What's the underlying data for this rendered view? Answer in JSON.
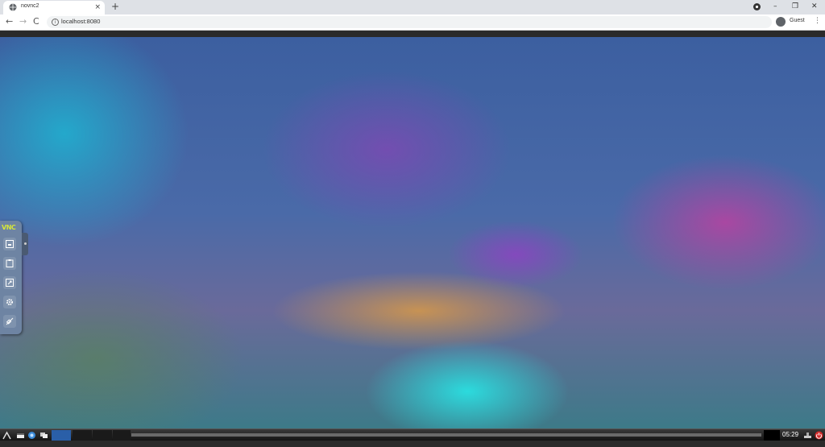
{
  "browser": {
    "tab_title": "novnc2",
    "tab_close": "×",
    "new_tab": "+",
    "url": "localhost:8080",
    "profile": "Guest",
    "back": "←",
    "forward": "→",
    "reload": "C",
    "menu": "⋮",
    "win_minimize": "–",
    "win_restore": "❐",
    "win_close": "✕"
  },
  "vnc": {
    "logo": "VNC",
    "buttons": [
      "keyboard-icon",
      "clipboard-icon",
      "fullscreen-icon",
      "settings-gear-icon",
      "disconnect-icon"
    ]
  },
  "taskbar": {
    "clock": "05:29"
  }
}
